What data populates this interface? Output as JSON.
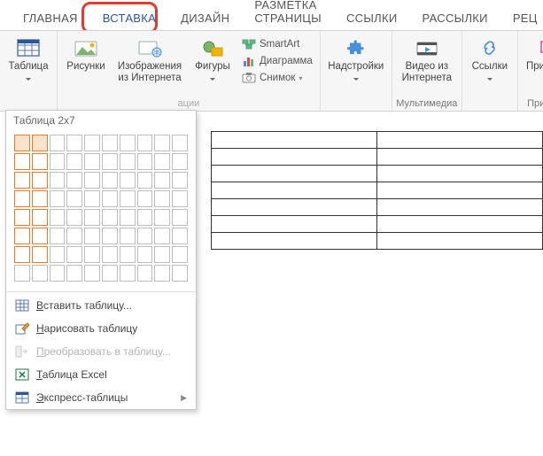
{
  "tabs": {
    "home": "ГЛАВНАЯ",
    "insert": "ВСТАВКА",
    "design": "ДИЗАЙН",
    "layout": "РАЗМЕТКА СТРАНИЦЫ",
    "references": "ССЫЛКИ",
    "mailings": "РАССЫЛКИ",
    "review": "РЕЦ"
  },
  "ribbon": {
    "table": {
      "label": "Таблица"
    },
    "pictures": {
      "label": "Рисунки"
    },
    "online_pictures": {
      "label": "Изображения из Интернета"
    },
    "shapes": {
      "label": "Фигуры"
    },
    "smartart": "SmartArt",
    "chart": "Диаграмма",
    "screenshot": "Снимок",
    "addins": {
      "label": "Надстройки"
    },
    "online_video": {
      "label": "Видео из Интернета"
    },
    "links": {
      "label": "Ссылки"
    },
    "comment": {
      "label": "Примечан"
    },
    "group_illustrations": "ации",
    "group_media": "Мультимедиа",
    "group_comments": "Примечан"
  },
  "dropdown": {
    "title": "Таблица 2x7",
    "grid": {
      "rows": 8,
      "cols": 10,
      "sel_rows": 7,
      "sel_cols": 2
    },
    "insert_table": "Вставить таблицу...",
    "draw_table": "Нарисовать таблицу",
    "convert": "Преобразовать в таблицу...",
    "excel": "Таблица Excel",
    "quick": "Экспресс-таблицы"
  },
  "preview": {
    "rows": 7,
    "cols": 2
  }
}
